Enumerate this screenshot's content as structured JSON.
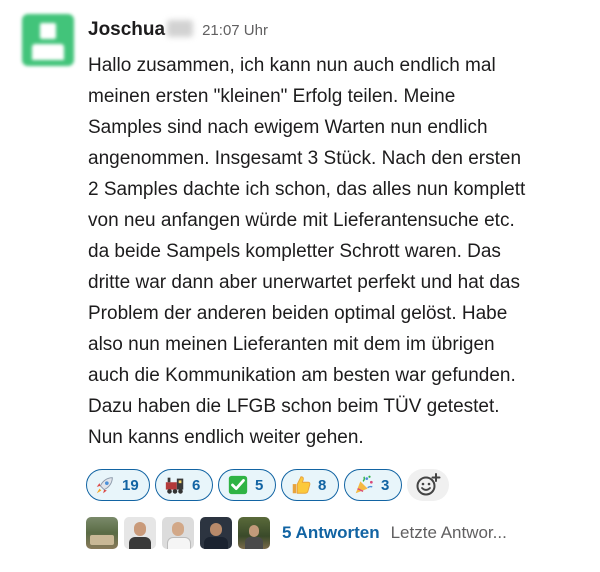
{
  "message": {
    "author": "Joschua",
    "timestamp": "21:07 Uhr",
    "lines": [
      "Hallo zusammen, ich kann nun auch endlich mal",
      "meinen ersten \"kleinen\" Erfolg teilen. Meine",
      "Samples sind nach ewigem Warten nun endlich",
      "angenommen. Insgesamt 3 Stück. Nach den ersten",
      "2 Samples dachte ich schon, das alles nun komplett",
      "von neu anfangen würde mit Lieferantensuche etc.",
      "da beide Sampels kompletter Schrott waren. Das",
      "dritte war dann aber unerwartet perfekt und hat das",
      "Problem der anderen beiden optimal gelöst. Habe",
      "also nun meinen Lieferanten mit dem im übrigen",
      "auch die Kommunikation am besten war gefunden.",
      "Dazu haben die LFGB schon beim TÜV getestet.",
      "Nun kanns endlich weiter gehen."
    ]
  },
  "reactions": [
    {
      "icon": "rocket-icon",
      "count": "19"
    },
    {
      "icon": "train-icon",
      "count": "6"
    },
    {
      "icon": "check-mark-icon",
      "count": "5"
    },
    {
      "icon": "thumbs-up-icon",
      "count": "8"
    },
    {
      "icon": "party-popper-icon",
      "count": "3"
    }
  ],
  "add_reaction": {
    "icon": "add-reaction-icon"
  },
  "thread": {
    "replies_label": "5 Antworten",
    "last_reply_label": "Letzte Antwor..."
  },
  "colors": {
    "link": "#1264a3",
    "reaction_bg": "#e8f5fa",
    "avatar": "#42c47a"
  }
}
